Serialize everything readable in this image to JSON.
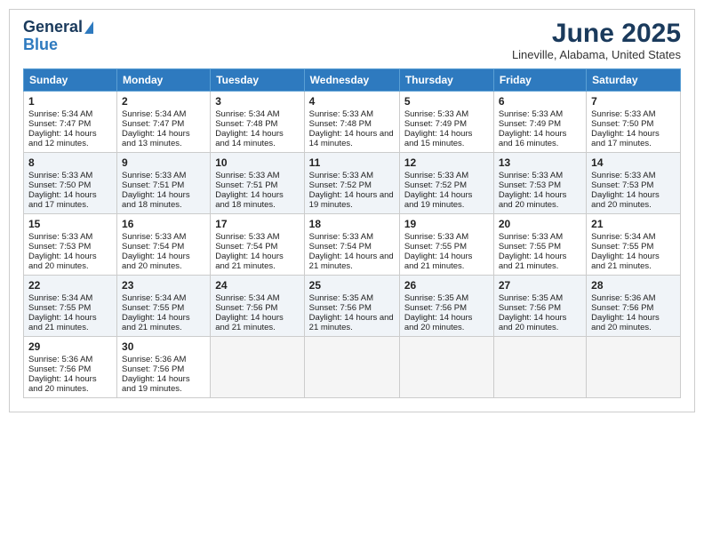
{
  "header": {
    "logo_line1": "General",
    "logo_line2": "Blue",
    "month_title": "June 2025",
    "location": "Lineville, Alabama, United States"
  },
  "weekdays": [
    "Sunday",
    "Monday",
    "Tuesday",
    "Wednesday",
    "Thursday",
    "Friday",
    "Saturday"
  ],
  "weeks": [
    [
      {
        "day": "1",
        "sunrise": "Sunrise: 5:34 AM",
        "sunset": "Sunset: 7:47 PM",
        "daylight": "Daylight: 14 hours and 12 minutes."
      },
      {
        "day": "2",
        "sunrise": "Sunrise: 5:34 AM",
        "sunset": "Sunset: 7:47 PM",
        "daylight": "Daylight: 14 hours and 13 minutes."
      },
      {
        "day": "3",
        "sunrise": "Sunrise: 5:34 AM",
        "sunset": "Sunset: 7:48 PM",
        "daylight": "Daylight: 14 hours and 14 minutes."
      },
      {
        "day": "4",
        "sunrise": "Sunrise: 5:33 AM",
        "sunset": "Sunset: 7:48 PM",
        "daylight": "Daylight: 14 hours and 14 minutes."
      },
      {
        "day": "5",
        "sunrise": "Sunrise: 5:33 AM",
        "sunset": "Sunset: 7:49 PM",
        "daylight": "Daylight: 14 hours and 15 minutes."
      },
      {
        "day": "6",
        "sunrise": "Sunrise: 5:33 AM",
        "sunset": "Sunset: 7:49 PM",
        "daylight": "Daylight: 14 hours and 16 minutes."
      },
      {
        "day": "7",
        "sunrise": "Sunrise: 5:33 AM",
        "sunset": "Sunset: 7:50 PM",
        "daylight": "Daylight: 14 hours and 17 minutes."
      }
    ],
    [
      {
        "day": "8",
        "sunrise": "Sunrise: 5:33 AM",
        "sunset": "Sunset: 7:50 PM",
        "daylight": "Daylight: 14 hours and 17 minutes."
      },
      {
        "day": "9",
        "sunrise": "Sunrise: 5:33 AM",
        "sunset": "Sunset: 7:51 PM",
        "daylight": "Daylight: 14 hours and 18 minutes."
      },
      {
        "day": "10",
        "sunrise": "Sunrise: 5:33 AM",
        "sunset": "Sunset: 7:51 PM",
        "daylight": "Daylight: 14 hours and 18 minutes."
      },
      {
        "day": "11",
        "sunrise": "Sunrise: 5:33 AM",
        "sunset": "Sunset: 7:52 PM",
        "daylight": "Daylight: 14 hours and 19 minutes."
      },
      {
        "day": "12",
        "sunrise": "Sunrise: 5:33 AM",
        "sunset": "Sunset: 7:52 PM",
        "daylight": "Daylight: 14 hours and 19 minutes."
      },
      {
        "day": "13",
        "sunrise": "Sunrise: 5:33 AM",
        "sunset": "Sunset: 7:53 PM",
        "daylight": "Daylight: 14 hours and 20 minutes."
      },
      {
        "day": "14",
        "sunrise": "Sunrise: 5:33 AM",
        "sunset": "Sunset: 7:53 PM",
        "daylight": "Daylight: 14 hours and 20 minutes."
      }
    ],
    [
      {
        "day": "15",
        "sunrise": "Sunrise: 5:33 AM",
        "sunset": "Sunset: 7:53 PM",
        "daylight": "Daylight: 14 hours and 20 minutes."
      },
      {
        "day": "16",
        "sunrise": "Sunrise: 5:33 AM",
        "sunset": "Sunset: 7:54 PM",
        "daylight": "Daylight: 14 hours and 20 minutes."
      },
      {
        "day": "17",
        "sunrise": "Sunrise: 5:33 AM",
        "sunset": "Sunset: 7:54 PM",
        "daylight": "Daylight: 14 hours and 21 minutes."
      },
      {
        "day": "18",
        "sunrise": "Sunrise: 5:33 AM",
        "sunset": "Sunset: 7:54 PM",
        "daylight": "Daylight: 14 hours and 21 minutes."
      },
      {
        "day": "19",
        "sunrise": "Sunrise: 5:33 AM",
        "sunset": "Sunset: 7:55 PM",
        "daylight": "Daylight: 14 hours and 21 minutes."
      },
      {
        "day": "20",
        "sunrise": "Sunrise: 5:33 AM",
        "sunset": "Sunset: 7:55 PM",
        "daylight": "Daylight: 14 hours and 21 minutes."
      },
      {
        "day": "21",
        "sunrise": "Sunrise: 5:34 AM",
        "sunset": "Sunset: 7:55 PM",
        "daylight": "Daylight: 14 hours and 21 minutes."
      }
    ],
    [
      {
        "day": "22",
        "sunrise": "Sunrise: 5:34 AM",
        "sunset": "Sunset: 7:55 PM",
        "daylight": "Daylight: 14 hours and 21 minutes."
      },
      {
        "day": "23",
        "sunrise": "Sunrise: 5:34 AM",
        "sunset": "Sunset: 7:55 PM",
        "daylight": "Daylight: 14 hours and 21 minutes."
      },
      {
        "day": "24",
        "sunrise": "Sunrise: 5:34 AM",
        "sunset": "Sunset: 7:56 PM",
        "daylight": "Daylight: 14 hours and 21 minutes."
      },
      {
        "day": "25",
        "sunrise": "Sunrise: 5:35 AM",
        "sunset": "Sunset: 7:56 PM",
        "daylight": "Daylight: 14 hours and 21 minutes."
      },
      {
        "day": "26",
        "sunrise": "Sunrise: 5:35 AM",
        "sunset": "Sunset: 7:56 PM",
        "daylight": "Daylight: 14 hours and 20 minutes."
      },
      {
        "day": "27",
        "sunrise": "Sunrise: 5:35 AM",
        "sunset": "Sunset: 7:56 PM",
        "daylight": "Daylight: 14 hours and 20 minutes."
      },
      {
        "day": "28",
        "sunrise": "Sunrise: 5:36 AM",
        "sunset": "Sunset: 7:56 PM",
        "daylight": "Daylight: 14 hours and 20 minutes."
      }
    ],
    [
      {
        "day": "29",
        "sunrise": "Sunrise: 5:36 AM",
        "sunset": "Sunset: 7:56 PM",
        "daylight": "Daylight: 14 hours and 20 minutes."
      },
      {
        "day": "30",
        "sunrise": "Sunrise: 5:36 AM",
        "sunset": "Sunset: 7:56 PM",
        "daylight": "Daylight: 14 hours and 19 minutes."
      },
      null,
      null,
      null,
      null,
      null
    ]
  ]
}
